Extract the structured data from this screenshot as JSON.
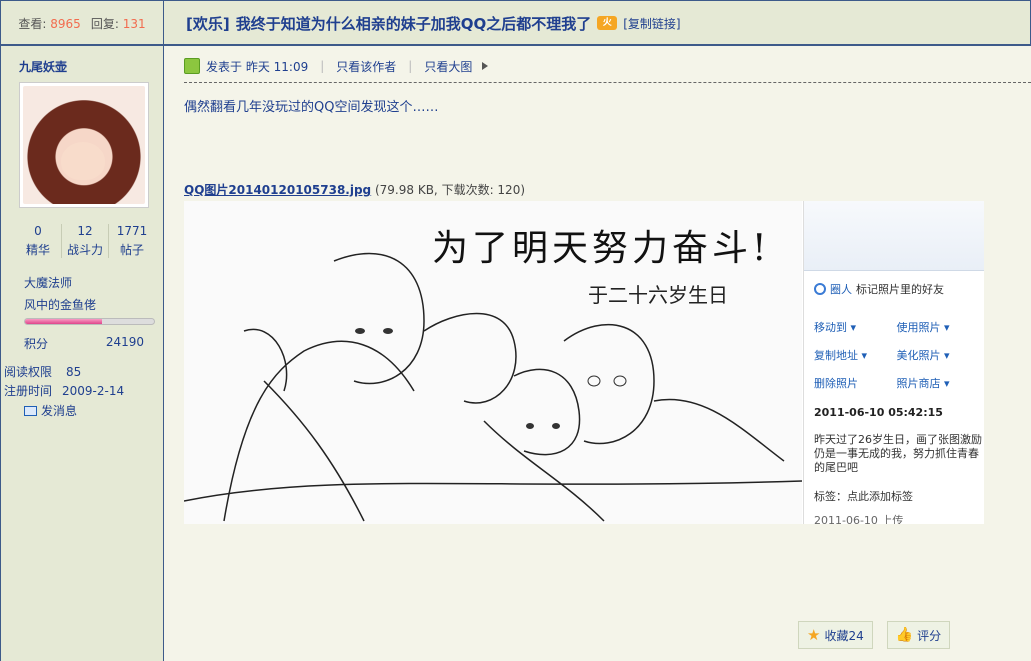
{
  "header": {
    "views_label": "查看:",
    "views_count": "8965",
    "replies_label": "回复:",
    "replies_count": "131",
    "thread_tag": "[欢乐]",
    "thread_title": "我终于知道为什么相亲的妹子加我QQ之后都不理我了",
    "hot_badge": "火",
    "copy_link": "[复制链接]"
  },
  "author": {
    "username": "九尾妖壶",
    "counts": [
      {
        "value": "0",
        "label": "精华"
      },
      {
        "value": "12",
        "label": "战斗力"
      },
      {
        "value": "1771",
        "label": "帖子"
      }
    ],
    "rank_title": "大魔法师",
    "rank_name": "风中的金鱼佬",
    "progress_fraction": 0.6,
    "score_label": "积分",
    "score_value": "24190",
    "read_perm_label": "阅读权限",
    "read_perm_value": "85",
    "reg_label": "注册时间",
    "reg_value": "2009-2-14",
    "send_message": "发消息"
  },
  "post": {
    "posted_at": "发表于 昨天 11:09",
    "only_author": "只看该作者",
    "only_large": "只看大图",
    "body": "偶然翻看几年没玩过的QQ空间发现这个……",
    "attachment_name": "QQ图片20140120105738.jpg",
    "attachment_info": "(79.98 KB, 下载次数: 120)"
  },
  "image": {
    "sketch_title": "为了明天努力奋斗!",
    "sketch_sub": "于二十六岁生日",
    "people_label": "圈人",
    "people_hint": "标记照片里的好友",
    "links": [
      "移动到 ▾",
      "使用照片 ▾",
      "复制地址 ▾",
      "美化照片 ▾",
      "删除照片",
      "照片商店 ▾"
    ],
    "date": "2011-06-10 05:42:15",
    "desc": "昨天过了26岁生日，画了张图激励仍是一事无成的我，努力抓住青春的尾巴吧",
    "tag": "标签：点此添加标签",
    "uploaded": "2011-06-10  上传"
  },
  "actions": {
    "favorite": "收藏24",
    "rate": "评分"
  }
}
